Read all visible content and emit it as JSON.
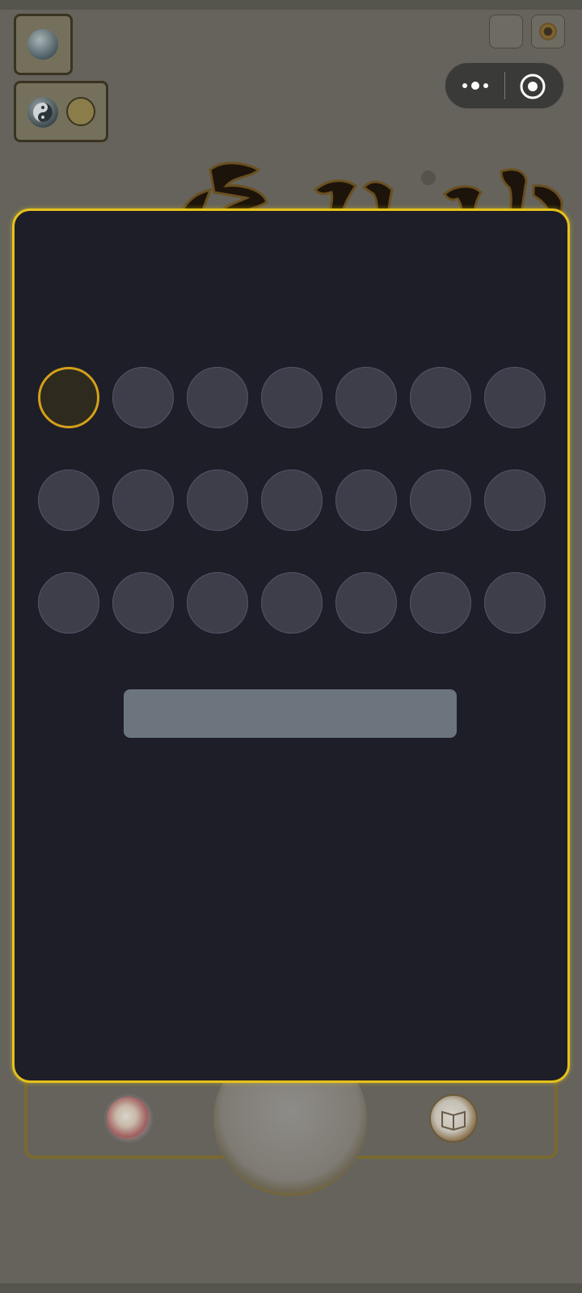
{
  "colors": {
    "modal_background": "#1e1e28",
    "modal_border": "#e6c21a",
    "slot_empty": "#3e3e4a",
    "slot_active_border": "#d4a019",
    "action_bar": "#6c757d",
    "overlay": "#65635b"
  },
  "background": {
    "top_left_buttons": [
      "globe-icon",
      "yin-yang-icon"
    ],
    "top_right_buttons": [
      "blank-button",
      "settings-icon"
    ],
    "miniprogram_capsule": [
      "more-icon",
      "close-target-icon"
    ],
    "dock_items": [
      "compass-icon",
      "main-orb",
      "book-icon"
    ]
  },
  "modal": {
    "rows": 3,
    "columns": 7,
    "active_slot_index": 0,
    "action_bar_label": ""
  }
}
